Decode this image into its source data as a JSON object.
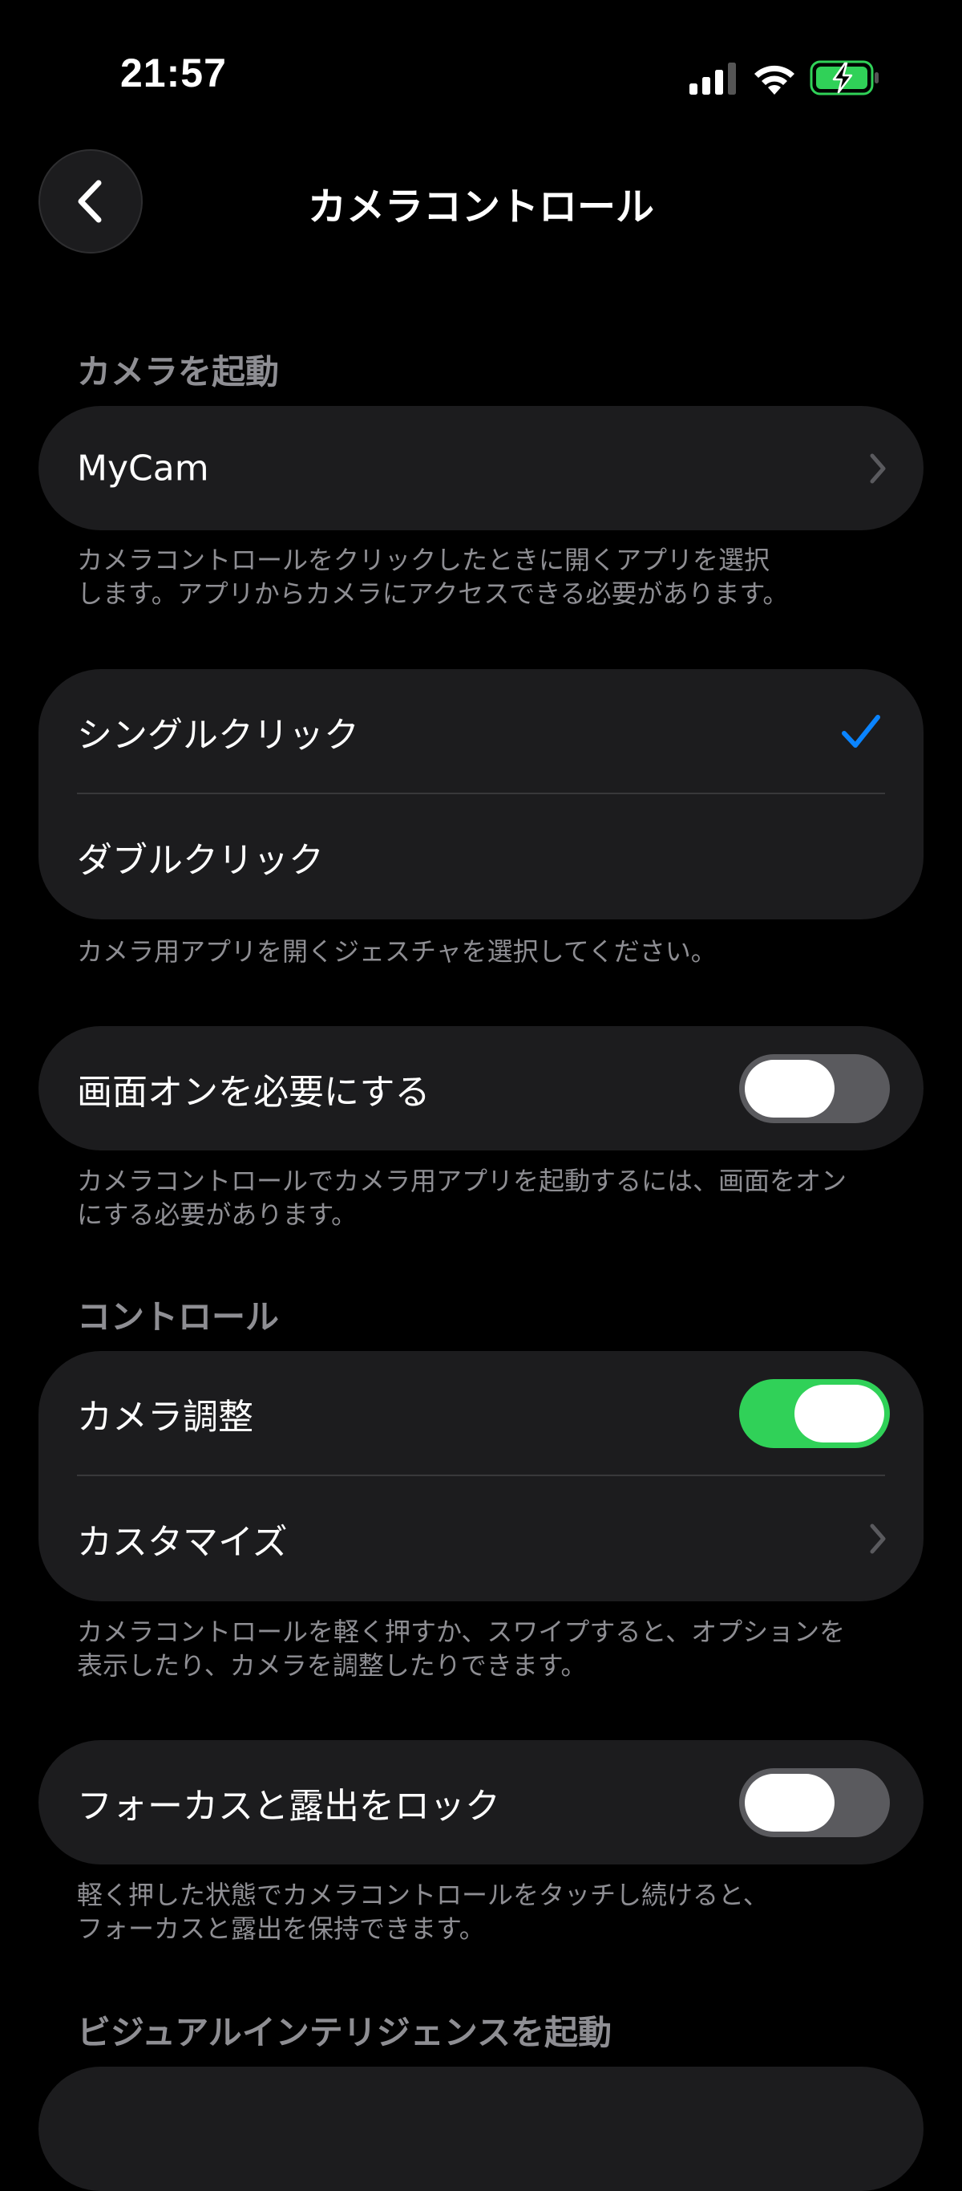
{
  "status_bar": {
    "time": "21:57"
  },
  "nav": {
    "title": "カメラコントロール"
  },
  "sections": {
    "launch_camera": {
      "header": "カメラを起動",
      "app_row_label": "MyCam",
      "footer": "カメラコントロールをクリックしたときに開くアプリを選択\nします。アプリからカメラにアクセスできる必要があります。"
    },
    "gesture": {
      "options": [
        "シングルクリック",
        "ダブルクリック"
      ],
      "selected": "シングルクリック",
      "footer": "カメラ用アプリを開くジェスチャを選択してください。"
    },
    "screen_on": {
      "label": "画面オンを必要にする",
      "toggle": false,
      "footer": "カメラコントロールでカメラ用アプリを起動するには、画面をオン\nにする必要があります。"
    },
    "controls": {
      "header": "コントロール",
      "camera_adjust_label": "カメラ調整",
      "camera_adjust_toggle": true,
      "customize_label": "カスタマイズ",
      "footer": "カメラコントロールを軽く押すか、スワイプすると、オプションを\n表示したり、カメラを調整したりできます。"
    },
    "lock_focus": {
      "label": "フォーカスと露出をロック",
      "toggle": false,
      "footer": "軽く押した状態でカメラコントロールをタッチし続けると、\nフォーカスと露出を保持できます。"
    },
    "visual_intelligence": {
      "header": "ビジュアルインテリジェンスを起動"
    }
  },
  "colors": {
    "background": "#000000",
    "card": "#1c1c1e",
    "secondary_text": "#8e8e93",
    "accent_blue": "#0a84ff",
    "toggle_on": "#30d158",
    "toggle_off": "#5a5a5e",
    "battery_green": "#30d158"
  },
  "icons": {
    "back": "chevron-left-icon",
    "disclosure": "chevron-right-icon",
    "selected": "checkmark-icon",
    "signal": "cellular-signal-icon",
    "wifi": "wifi-icon",
    "battery": "battery-charging-icon"
  }
}
